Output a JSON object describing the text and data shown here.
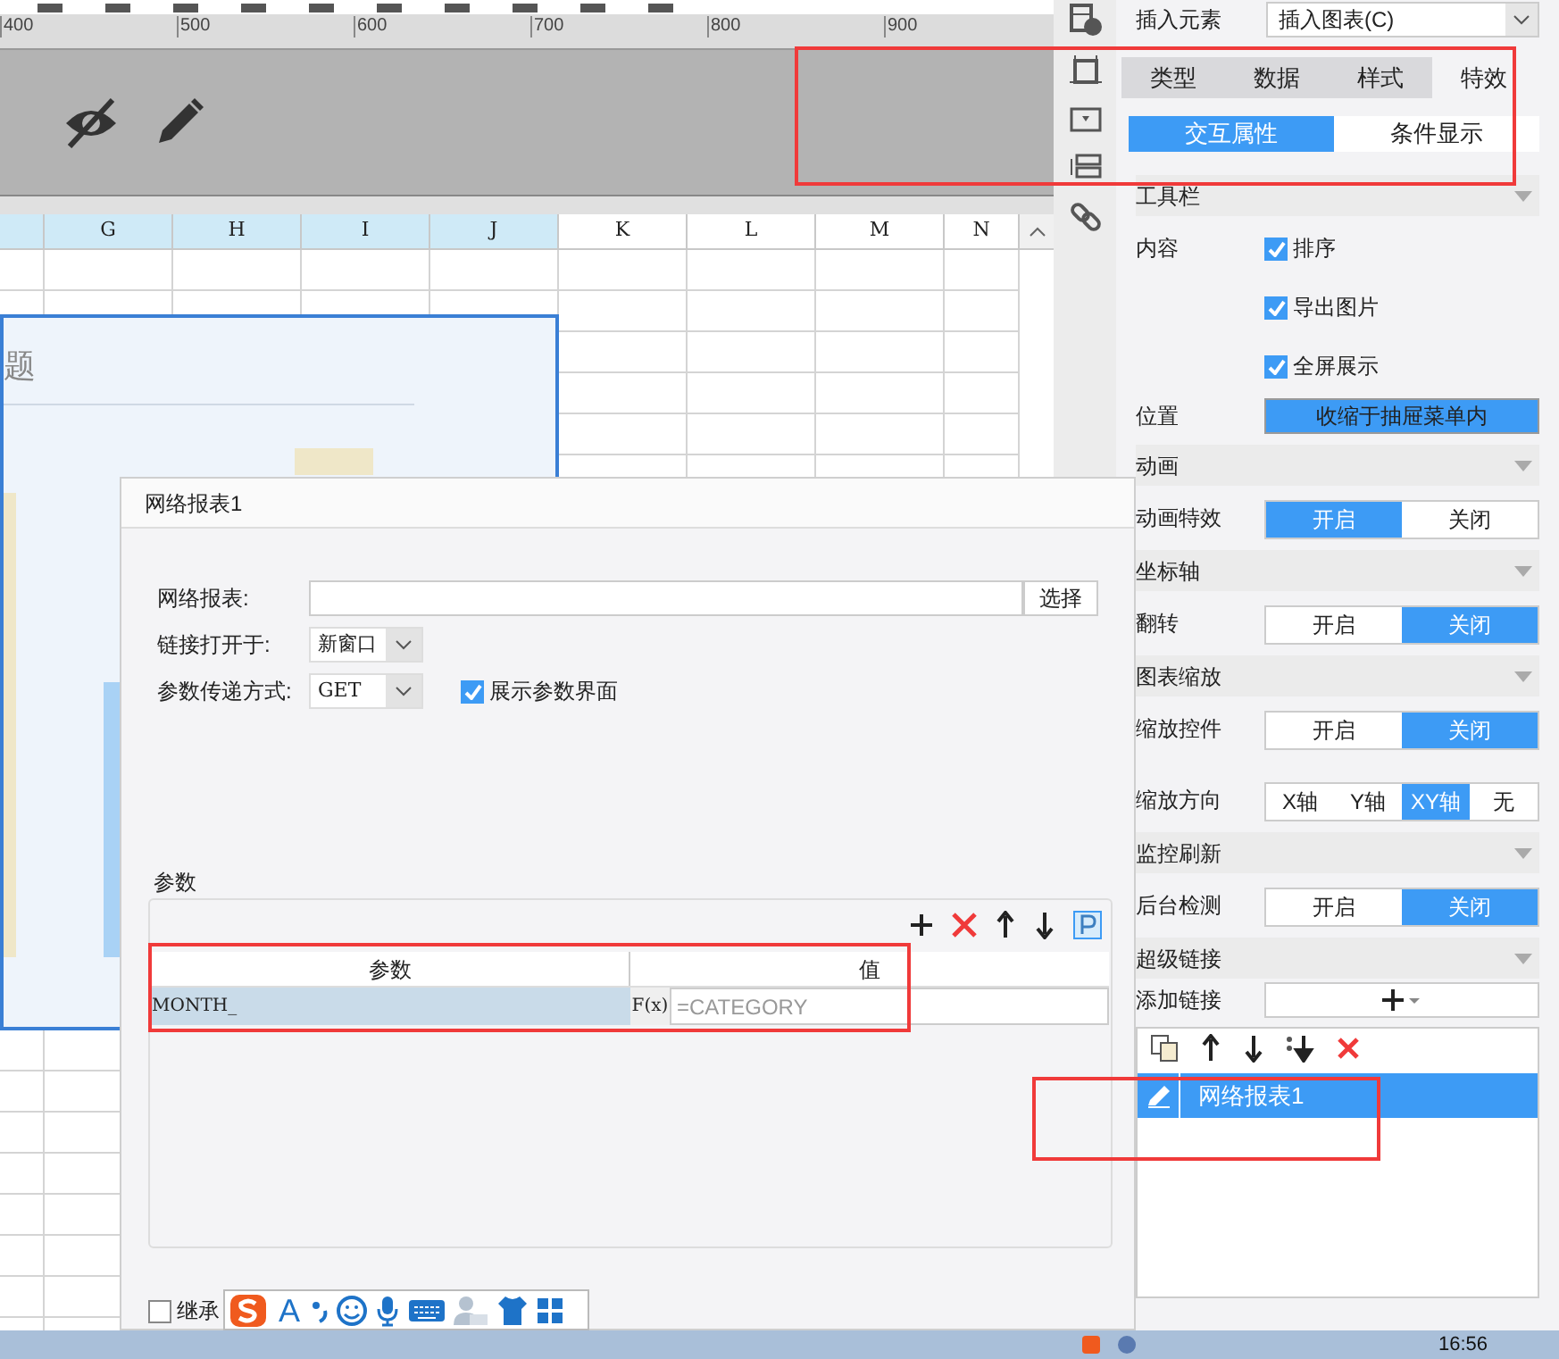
{
  "ruler": {
    "labels": [
      "400",
      "500",
      "600",
      "700",
      "800",
      "900"
    ]
  },
  "columns": [
    {
      "label": "G",
      "selected": true
    },
    {
      "label": "H",
      "selected": true
    },
    {
      "label": "I",
      "selected": true
    },
    {
      "label": "J",
      "selected": true
    },
    {
      "label": "K",
      "selected": false
    },
    {
      "label": "L",
      "selected": false
    },
    {
      "label": "M",
      "selected": false
    },
    {
      "label": "N",
      "selected": false
    }
  ],
  "report": {
    "title": "题"
  },
  "panel": {
    "insert": {
      "label": "插入元素",
      "value": "插入图表(C)"
    },
    "tabs": [
      {
        "label": "类型",
        "selected": false
      },
      {
        "label": "数据",
        "selected": false
      },
      {
        "label": "样式",
        "selected": false
      },
      {
        "label": "特效",
        "selected": true
      }
    ],
    "subtabs": [
      {
        "label": "交互属性",
        "selected": true
      },
      {
        "label": "条件显示",
        "selected": false
      }
    ],
    "sections": [
      {
        "title": "工具栏",
        "expanded": true,
        "rows": [
          {
            "kind": "checks",
            "label": "内容",
            "items": [
              {
                "label": "排序",
                "checked": true
              },
              {
                "label": "导出图片",
                "checked": true
              },
              {
                "label": "全屏展示",
                "checked": true
              }
            ]
          },
          {
            "kind": "button",
            "label": "位置",
            "value": "收缩于抽屉菜单内"
          }
        ]
      },
      {
        "title": "动画",
        "expanded": true,
        "rows": [
          {
            "kind": "toggle",
            "label": "动画特效",
            "options": [
              {
                "label": "开启",
                "selected": true
              },
              {
                "label": "关闭",
                "selected": false
              }
            ]
          }
        ]
      },
      {
        "title": "坐标轴",
        "expanded": true,
        "rows": [
          {
            "kind": "toggle",
            "label": "翻转",
            "options": [
              {
                "label": "开启",
                "selected": false
              },
              {
                "label": "关闭",
                "selected": true
              }
            ]
          }
        ]
      },
      {
        "title": "图表缩放",
        "expanded": true,
        "rows": [
          {
            "kind": "toggle",
            "label": "缩放控件",
            "options": [
              {
                "label": "开启",
                "selected": false
              },
              {
                "label": "关闭",
                "selected": true
              }
            ]
          },
          {
            "kind": "toggle",
            "label": "缩放方向",
            "options": [
              {
                "label": "X轴",
                "selected": false
              },
              {
                "label": "Y轴",
                "selected": false
              },
              {
                "label": "XY轴",
                "selected": true
              },
              {
                "label": "无",
                "selected": false
              }
            ]
          }
        ]
      },
      {
        "title": "监控刷新",
        "expanded": true,
        "rows": [
          {
            "kind": "toggle",
            "label": "后台检测",
            "options": [
              {
                "label": "开启",
                "selected": false
              },
              {
                "label": "关闭",
                "selected": true
              }
            ]
          }
        ]
      },
      {
        "title": "超级链接",
        "expanded": true,
        "rows": [
          {
            "kind": "add",
            "label": "添加链接"
          }
        ]
      }
    ],
    "links": [
      {
        "label": "网络报表1",
        "selected": true
      }
    ]
  },
  "dialog": {
    "title": "网络报表1",
    "fields": [
      {
        "kind": "input",
        "label": "网络报表:",
        "button": "选择"
      },
      {
        "kind": "select",
        "label": "链接打开于:",
        "value": "新窗口"
      },
      {
        "kind": "select",
        "label": "参数传递方式:",
        "value": "GET",
        "checkbox": {
          "label": "展示参数界面",
          "checked": true
        }
      }
    ],
    "params": {
      "title": "参数",
      "columns": [
        "参数",
        "值"
      ],
      "rows": [
        {
          "name": "MONTH_",
          "selected": true,
          "formula": "F(x)",
          "placeholder": "=CATEGORY"
        }
      ]
    },
    "inherit": {
      "label": "继承",
      "checked": false
    }
  },
  "ime_toolbar": {
    "letter": "A"
  },
  "taskbar": {
    "time": "16:56"
  }
}
